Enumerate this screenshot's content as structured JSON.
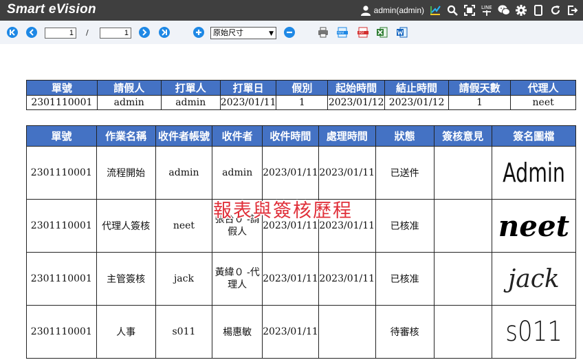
{
  "app": {
    "title": "Smart eVision",
    "user": "admin(admin)"
  },
  "topbar_icons": [
    "user-icon",
    "chart-icon",
    "search-icon",
    "fullscreen-icon",
    "line-icon",
    "wechat-icon",
    "gear-icon",
    "mobile-icon",
    "refresh-icon",
    "logout-icon"
  ],
  "toolbar": {
    "current_page": "1",
    "page_separator": "/",
    "total_pages": "1",
    "zoom_value": "原始尺寸",
    "export_icons": [
      "print-icon",
      "html-icon",
      "pdf-icon",
      "excel-icon",
      "word-icon"
    ]
  },
  "summary_table": {
    "headers": [
      "單號",
      "請假人",
      "打單人",
      "打單日",
      "假別",
      "起始時間",
      "結止時間",
      "請假天數",
      "代理人"
    ],
    "rows": [
      [
        "2301110001",
        "admin",
        "admin",
        "2023/01/11",
        "1",
        "2023/01/12",
        "2023/01/12",
        "1",
        "neet"
      ]
    ]
  },
  "history_table": {
    "headers": [
      "單號",
      "作業名稱",
      "收件者帳號",
      "收件者",
      "收件時間",
      "處理時間",
      "狀態",
      "簽核意見",
      "簽名圖檔"
    ],
    "rows": [
      {
        "cells": [
          "2301110001",
          "流程開始",
          "admin",
          "admin",
          "2023/01/11",
          "2023/01/11",
          "已送件",
          ""
        ],
        "signature": "Admin"
      },
      {
        "cells": [
          "2301110001",
          "代理人簽核",
          "neet",
          "張台０ -請假人",
          "2023/01/11",
          "2023/01/11",
          "已核准",
          ""
        ],
        "signature": "neet"
      },
      {
        "cells": [
          "2301110001",
          "主管簽核",
          "jack",
          "黃緯０ -代理人",
          "2023/01/11",
          "2023/01/11",
          "已核准",
          ""
        ],
        "signature": "jack"
      },
      {
        "cells": [
          "2301110001",
          "人事",
          "s011",
          "楊惠敏",
          "2023/01/11",
          "",
          "待審核",
          ""
        ],
        "signature": "s011"
      }
    ]
  },
  "overlay_caption": "報表與簽核歷程",
  "colors": {
    "topbar": "#3f3f3f",
    "header_blue": "#4472c4",
    "toolbar_blue": "#1e88e5",
    "caption_red": "#e0303a"
  }
}
